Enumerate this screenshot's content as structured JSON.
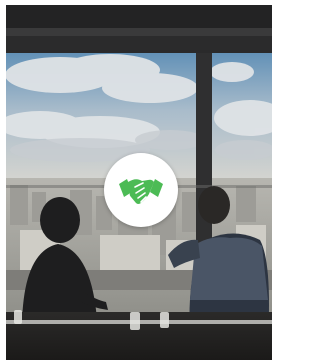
{
  "photo": {
    "description_icon": "handshake-icon"
  },
  "colors": {
    "badge_background": "#ffffff",
    "icon_green": "#4cbb55"
  }
}
